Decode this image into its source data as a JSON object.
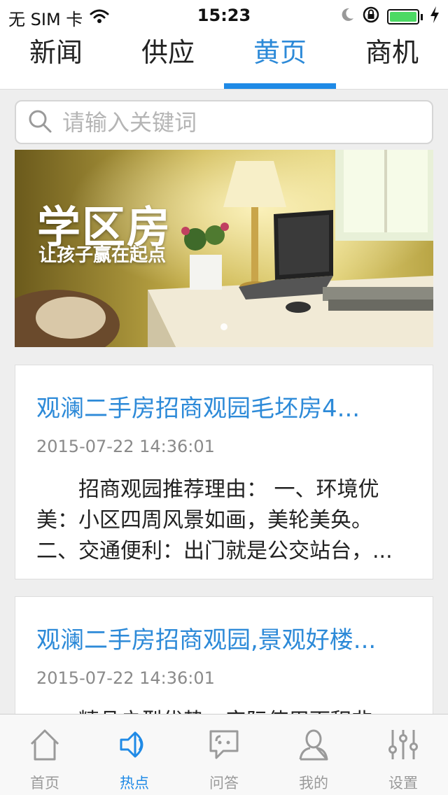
{
  "status_bar": {
    "carrier": "无 SIM 卡",
    "time": "15:23",
    "icons": [
      "wifi-icon",
      "moon-icon",
      "rotation-lock-icon",
      "battery-icon",
      "charging-icon"
    ],
    "battery_color": "#4cd964"
  },
  "top_tabs": [
    {
      "label": "新闻",
      "active": false
    },
    {
      "label": "供应",
      "active": false
    },
    {
      "label": "黄页",
      "active": true
    },
    {
      "label": "商机",
      "active": false
    }
  ],
  "accent_color": "#1f8ae6",
  "search": {
    "placeholder": "请输入关键词",
    "value": "",
    "icon": "search-icon"
  },
  "banner": {
    "headline": "学区房",
    "subline": "让孩子赢在起点",
    "page_count": 1,
    "active_page": 1
  },
  "articles": [
    {
      "title": "观澜二手房招商观园毛坯房4...",
      "date": "2015-07-22 14:36:01",
      "excerpt": "招商观园推荐理由： 一、环境优美：小区四周风景如画，美轮美奂。二、交通便利：出门就是公交站台，..."
    },
    {
      "title": "观澜二手房招商观园,景观好楼...",
      "date": "2015-07-22 14:36:01",
      "excerpt": "精品户型优势：实际使用面积非常..."
    }
  ],
  "tab_bar": [
    {
      "label": "首页",
      "icon": "home-icon",
      "active": false
    },
    {
      "label": "热点",
      "icon": "speaker-icon",
      "active": true
    },
    {
      "label": "问答",
      "icon": "chat-bubble-icon",
      "active": false
    },
    {
      "label": "我的",
      "icon": "user-icon",
      "active": false
    },
    {
      "label": "设置",
      "icon": "sliders-icon",
      "active": false
    }
  ]
}
